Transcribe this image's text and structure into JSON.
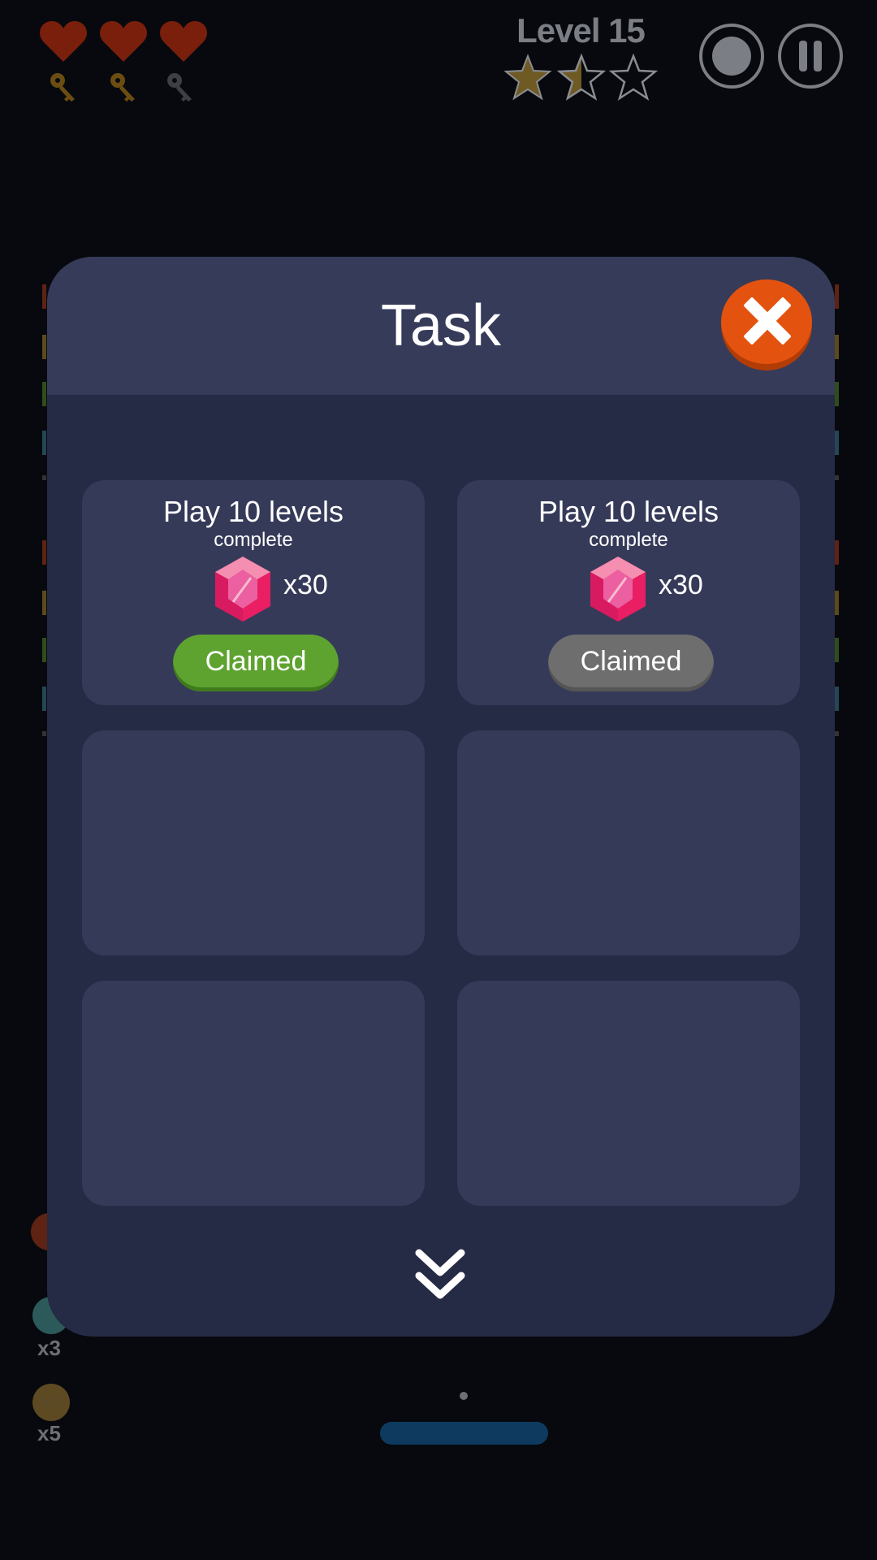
{
  "hud": {
    "level_label": "Level 15",
    "hearts": 3,
    "keys": [
      {
        "state": "collected"
      },
      {
        "state": "collected"
      },
      {
        "state": "empty"
      }
    ],
    "stars_earned": 1.5,
    "stars_total": 3,
    "colors": {
      "heart": "#7a1f0c",
      "key_gold": "#6b4d12",
      "key_grey": "#3e3f44",
      "star": "#6f5a24"
    }
  },
  "powerups": [
    {
      "icon": "x3",
      "count": "x3"
    },
    {
      "icon": "x3",
      "count": "x5"
    }
  ],
  "modal": {
    "title": "Task",
    "tasks": [
      {
        "title": "Play 10 levels",
        "subtitle": "complete",
        "reward_icon": "pink-gem-icon",
        "reward_qty": "x30",
        "button_label": "Claimed",
        "button_color": "#5ea330"
      },
      {
        "title": "Play 10 levels",
        "subtitle": "complete",
        "reward_icon": "pink-gem-icon",
        "reward_qty": "x30",
        "button_label": "Claimed",
        "button_color": "#6e6e6e"
      }
    ],
    "empty_slots": 4
  }
}
